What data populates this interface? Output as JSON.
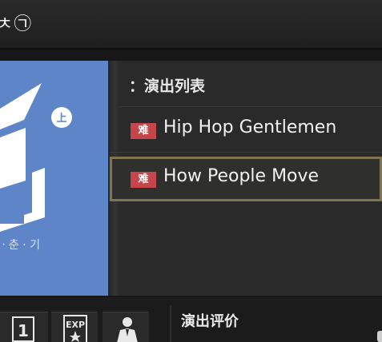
{
  "topbar": {
    "currency_text": "ㅊ㉠"
  },
  "album": {
    "caption": "ㆍ춘 · 기",
    "badge": "上"
  },
  "song_list": {
    "title": "：演出列表",
    "songs": [
      {
        "difficulty": "难",
        "name": "Hip Hop Gentlemen",
        "selected": false
      },
      {
        "difficulty": "难",
        "name": "How People Move",
        "selected": true
      }
    ]
  },
  "bottom": {
    "evaluation_label": "演出评价",
    "icons": [
      "rank-one-icon",
      "exp-star-icon",
      "performer-icon"
    ],
    "rank_value": "1",
    "exp_text": "EXP"
  },
  "colors": {
    "album_bg": "#5f85c9",
    "badge_red": "#c6454b",
    "selection_border": "#7e7550"
  }
}
